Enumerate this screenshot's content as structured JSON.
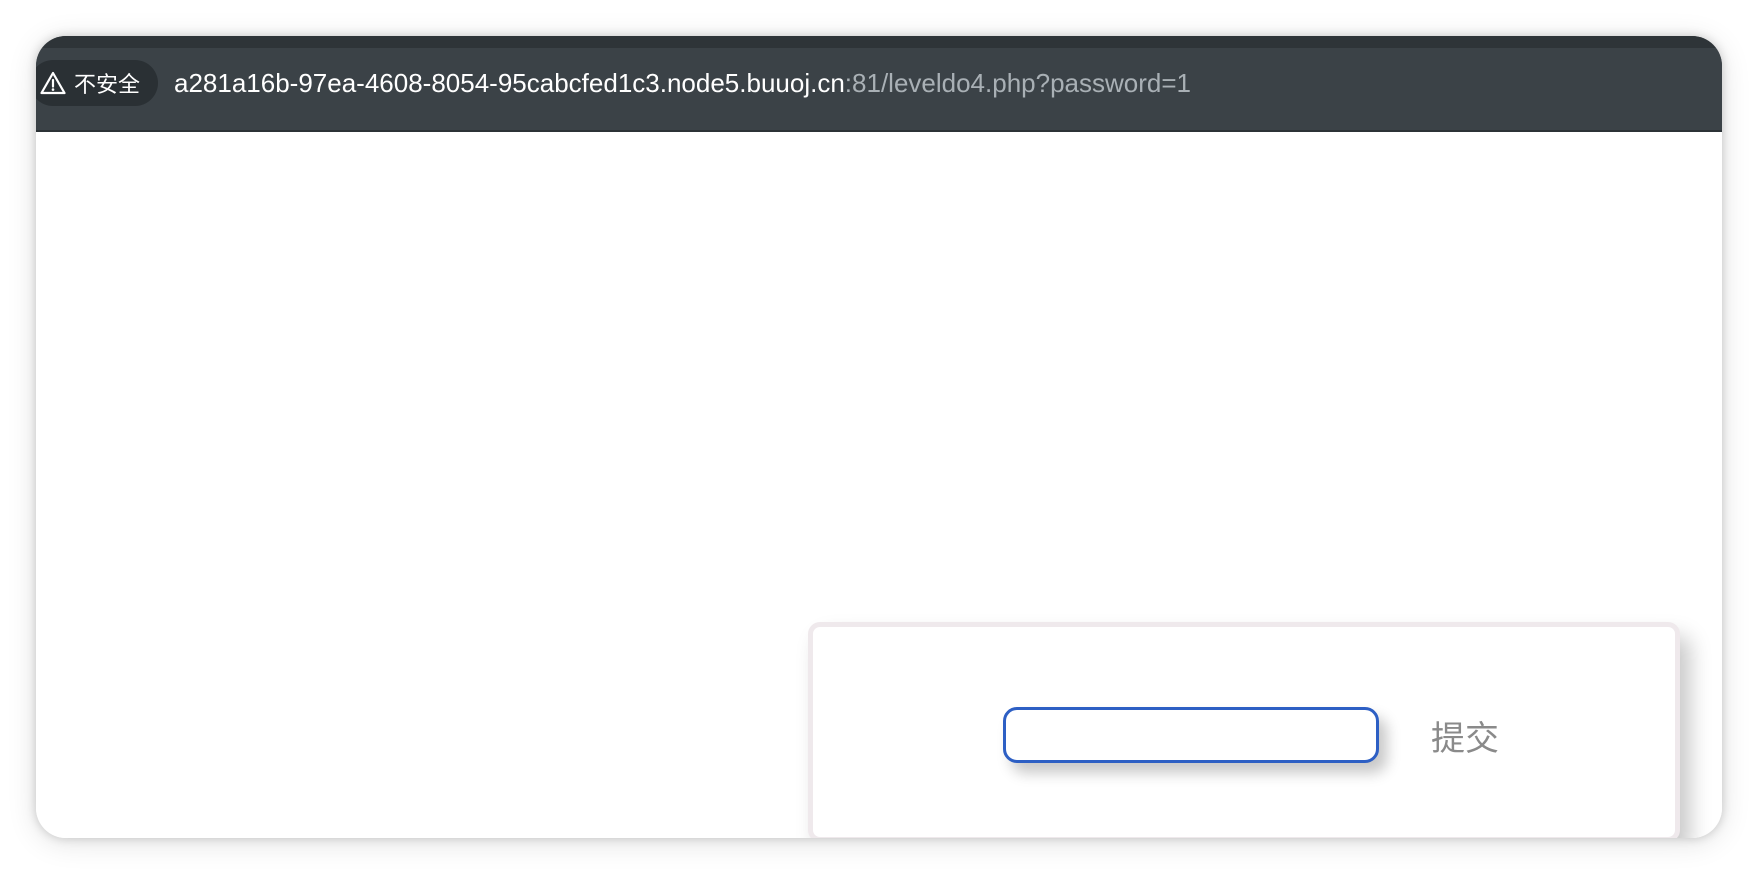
{
  "address_bar": {
    "security_label": "不安全",
    "security_icon": "warning-triangle-icon",
    "url_host": "a281a16b-97ea-4608-8054-95cabcfed1c3.node5.buuoj.cn",
    "url_rest": ":81/leveldo4.php?password=1"
  },
  "form": {
    "input_value": "",
    "submit_label": "提交"
  },
  "colors": {
    "toolbar_bg": "#3b4247",
    "input_border": "#2d5fc4",
    "submit_text": "#8a8a8a"
  }
}
